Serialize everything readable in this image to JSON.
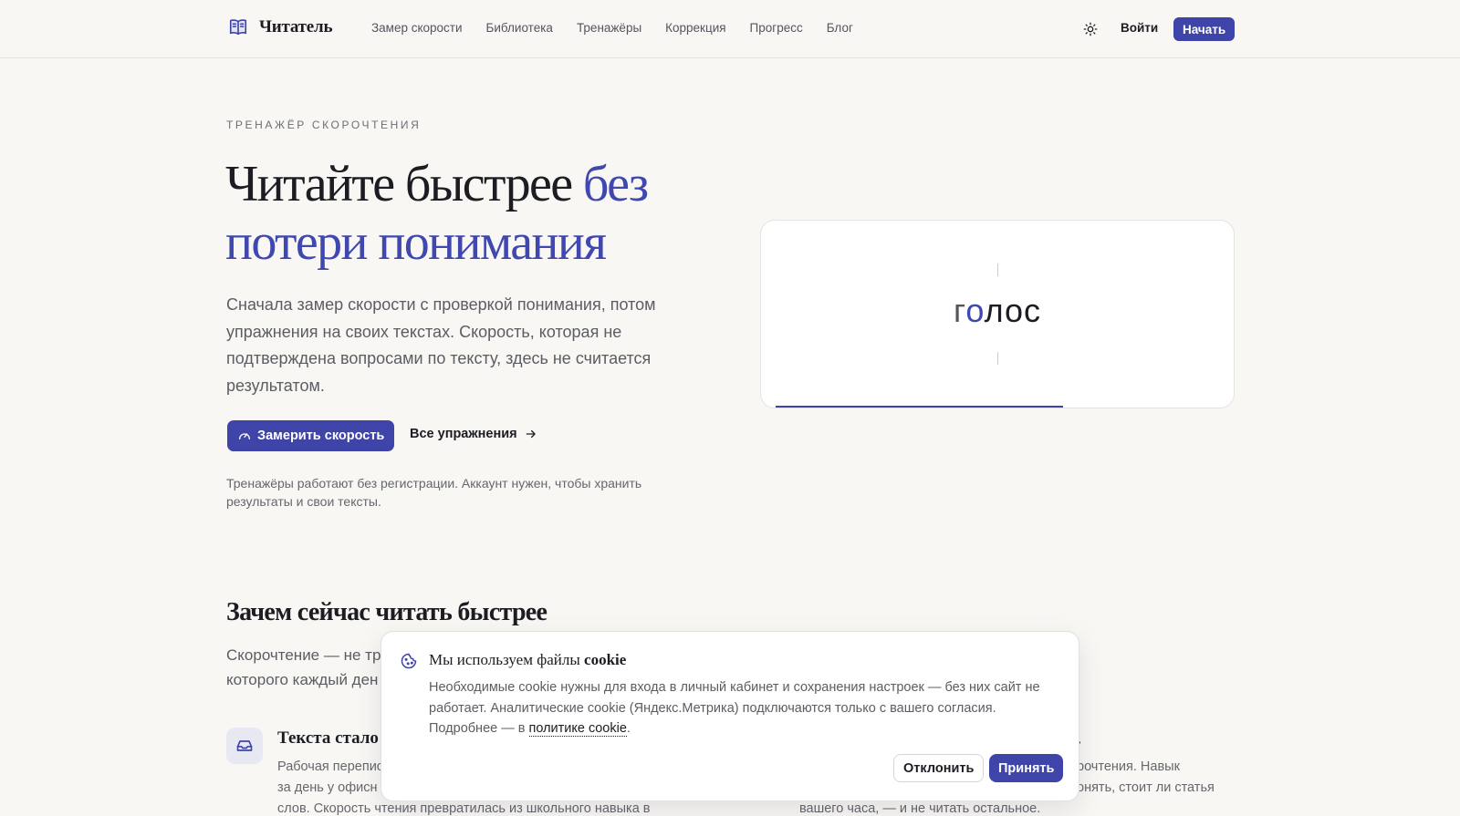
{
  "header": {
    "logo_text": "Читатель",
    "nav": [
      "Замер скорости",
      "Библиотека",
      "Тренажёры",
      "Коррекция",
      "Прогресс",
      "Блог"
    ],
    "login_label": "Войти",
    "start_label": "Начать"
  },
  "hero": {
    "eyebrow": "ТРЕНАЖЁР СКОРОЧТЕНИЯ",
    "title_plain": "Читайте быстрее ",
    "title_accent": "без потери понимания",
    "lead": "Сначала замер скорости с проверкой понимания, потом упражнения на своих текстах. Скорость, которая не подтверждена вопросами по тексту, здесь не считается результатом.",
    "cta_primary": "Замерить скорость",
    "cta_secondary": "Все упражнения",
    "note": "Тренажёры работают без регистрации. Аккаунт нужен, чтобы хранить результаты и свои тексты."
  },
  "rsvp": {
    "word_pre": "г",
    "word_focus": "о",
    "word_post": "лос",
    "progress": 0.645
  },
  "why": {
    "title": "Зачем сейчас читать быстрее",
    "lead_visible": "Скорочтение — не тр",
    "lead_visible_2": "которого каждый ден",
    "feature1_title": "Текста стало бо",
    "feature1_text_1": "Рабочая перепис",
    "feature1_text_2": "за день у офисн",
    "feature1_text_3": "слов. Скорость чтения превратилась из школьного навыка в",
    "feature2_title": ".",
    "feature2_text_1": "рочтения. Навык",
    "feature2_text_2": "онять, стоит ли статья",
    "feature2_text_3": "вашего часа, — и не читать остальное."
  },
  "cookie": {
    "title_plain": "Мы используем файлы ",
    "title_bold": "cookie",
    "text": "Необходимые cookie нужны для входа в личный кабинет и сохранения настроек — без них сайт не работает. Аналитические cookie (Яндекс.Метрика) подключаются только с вашего согласия. Подробнее — в ",
    "link": "политике cookie",
    "text_end": ".",
    "decline_label": "Отклонить",
    "accept_label": "Принять"
  },
  "icons": {
    "logo": "book-icon",
    "theme": "sun-icon",
    "cta": "gauge-icon",
    "arrow": "arrow-right-icon",
    "feature": "inbox-icon",
    "cookie": "cookie-icon"
  },
  "colors": {
    "accent": "#3f45a8",
    "background": "#f8f7f4",
    "text": "#1c1c22"
  }
}
